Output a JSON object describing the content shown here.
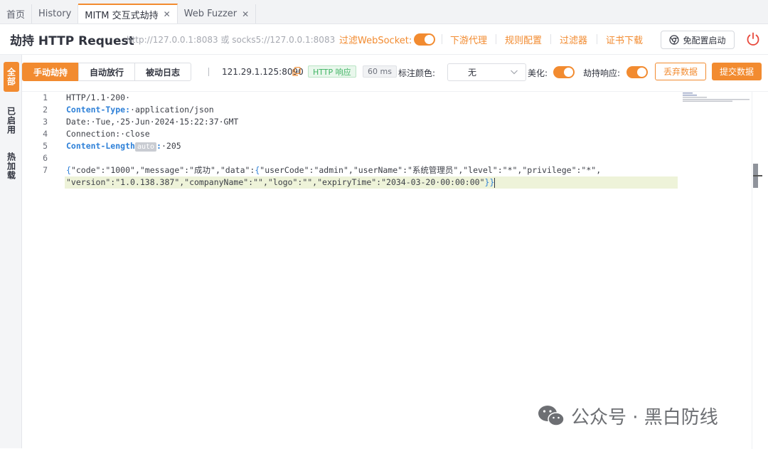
{
  "tabs": [
    {
      "label": "首页",
      "active": false,
      "closable": false
    },
    {
      "label": "History",
      "active": false,
      "closable": false
    },
    {
      "label": "MITM 交互式劫持",
      "active": true,
      "closable": true
    },
    {
      "label": "Web Fuzzer",
      "active": false,
      "closable": true
    }
  ],
  "tab_close_glyph": "✕",
  "header": {
    "title": "劫持 HTTP Request",
    "proxy_address": "http://127.0.0.1:8083 或 socks5://127.0.0.1:8083",
    "filter_websocket_label": "过滤WebSocket:",
    "filter_websocket_on": true,
    "downstream_proxy": "下游代理",
    "rule_config": "规则配置",
    "filter": "过滤器",
    "cert_download": "证书下载",
    "start_button": "免配置启动",
    "icons": [
      "chrome-icon",
      "power-icon"
    ]
  },
  "siderail": {
    "items": [
      {
        "label": "全部",
        "active": true
      },
      {
        "label": "已启用",
        "active": false
      },
      {
        "label": "热加载",
        "active": false
      }
    ]
  },
  "toolbar": {
    "modes": [
      "手动劫持",
      "自动放行",
      "被动日志"
    ],
    "active_mode": "手动劫持",
    "separator": "|",
    "host": "121.29.1.125:8090",
    "http_tag": "HTTP 响应",
    "latency": "60 ms",
    "color_label": "标注颜色:",
    "color_value": "无",
    "beautify_label": "美化:",
    "beautify_on": true,
    "hijack_response_label": "劫持响应:",
    "hijack_response_on": true,
    "discard_button": "丢弃数据",
    "submit_button": "提交数据"
  },
  "editor": {
    "line_numbers": [
      "1",
      "2",
      "3",
      "4",
      "5",
      "6",
      "7"
    ],
    "lines": {
      "l1": "HTTP/1.1·200·",
      "l2_key": "Content-Type:",
      "l2_val": "·application/json",
      "l3": "Date:·Tue,·25·Jun·2024·15:22:37·GMT",
      "l4": "Connection:·close",
      "l5_key": "Content-Length",
      "l5_badge": "auto",
      "l5_colon": ":",
      "l5_val": "·205",
      "l7a_brace": "{",
      "l7a": "\"code\":\"1000\",\"message\":\"成功\",\"data\":",
      "l7a_brace2": "{",
      "l7a_rest": "\"userCode\":\"admin\",\"userName\":\"系统管理员\",\"level\":\"*\",\"privilege\":\"*\",",
      "l7b": "\"version\":\"1.0.138.387\",\"companyName\":\"\",\"logo\":\"\",\"expiryTime\":\"2034-03-20·00:00:00\"",
      "l7b_brace": "}}"
    }
  },
  "watermark": "公众号 · 黑白防线",
  "colors": {
    "accent": "#f28b30",
    "key_blue": "#2f81d8",
    "tag_green": "#40b464"
  }
}
